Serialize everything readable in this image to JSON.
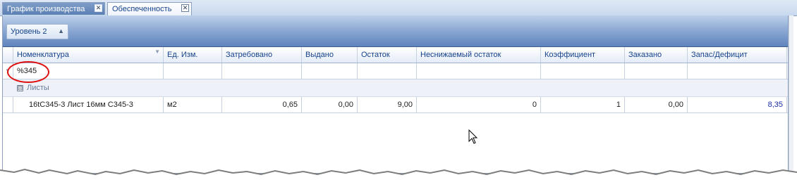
{
  "tabs": [
    {
      "label": "График производства",
      "active": false
    },
    {
      "label": "Обеспеченность",
      "active": true
    }
  ],
  "tab_close_glyph": "✕",
  "group_level": {
    "label": "Уровень 2",
    "arrow": "▲"
  },
  "grid": {
    "columns": [
      "Номенклатура",
      "Ед. Изм.",
      "Затребовано",
      "Выдано",
      "Остаток",
      "Неснижаемый остаток",
      "Коэффициент",
      "Заказано",
      "Запас/Дефицит"
    ],
    "filter_value": "%345",
    "group": {
      "expander": "⊟",
      "label": "Листы"
    },
    "rows": [
      {
        "nomenclature": "16tC345-3 Лист 16мм С345-3",
        "unit": "м2",
        "requested": "0,65",
        "issued": "0,00",
        "remainder": "9,00",
        "minimum_remainder": "0",
        "coefficient": "1",
        "ordered": "0,00",
        "stock_deficit": "8,35"
      }
    ]
  },
  "colors": {
    "accent": "#15428b",
    "highlight": "#e01010",
    "value_blue": "#1a2ea6"
  },
  "icons": [
    "close-icon",
    "sort-arrow-icon",
    "filter-icon",
    "collapse-group-icon",
    "mouse-cursor-icon"
  ]
}
